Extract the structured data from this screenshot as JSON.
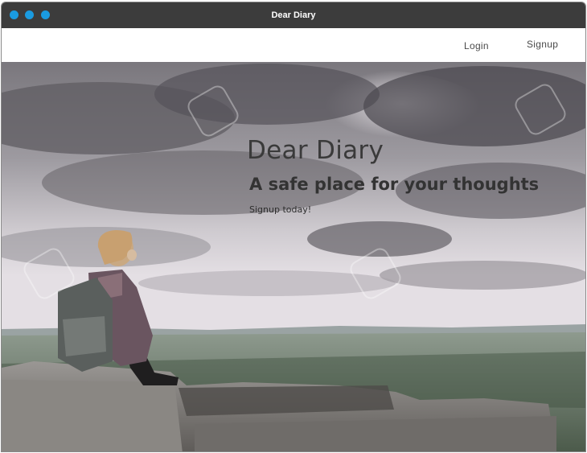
{
  "window": {
    "title": "Dear Diary",
    "controls": [
      "close-icon",
      "minimize-icon",
      "maximize-icon"
    ],
    "control_color": "#1a9be0",
    "titlebar_color": "#3c3c3c"
  },
  "navbar": {
    "login_label": "Login",
    "signup_label": "Signup"
  },
  "hero": {
    "title": "Dear Diary",
    "subtitle": "A safe place for your thoughts",
    "cta_label": "Signup today!",
    "image": "hiker-sitting-on-rock-overlooking-valley"
  }
}
